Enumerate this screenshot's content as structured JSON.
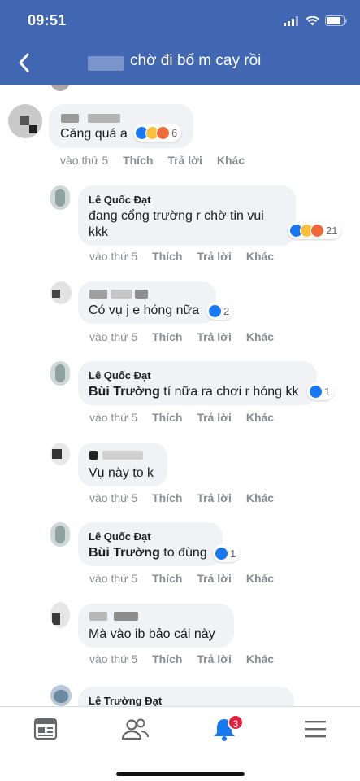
{
  "status_bar": {
    "time": "09:51"
  },
  "header": {
    "title": "chờ đi bố m cay rồi"
  },
  "comments": [
    {
      "text": "Căng quá a",
      "reaction_count": "6",
      "time": "vào thứ 5"
    },
    {
      "name": "Lê Quốc Đạt",
      "text_line1": "đang cổng trường r chờ tin vui",
      "text_line2": "kkk",
      "reaction_count": "21",
      "time": "vào thứ 5"
    },
    {
      "text": "Có vụ j e hóng nữa",
      "reaction_count": "2",
      "time": "vào thứ 5"
    },
    {
      "name": "Lê Quốc Đạt",
      "tag": "Bùi Trường",
      "text": " tí nữa ra chơi r hóng kk",
      "reaction_count": "1",
      "time": "vào thứ 5"
    },
    {
      "text": "Vụ này to k",
      "time": "vào thứ 5"
    },
    {
      "name": "Lê Quốc Đạt",
      "tag": "Bùi Trường",
      "text": " to đùng",
      "reaction_count": "1",
      "time": "vào thứ 5"
    },
    {
      "text": "Mà vào ib bảo cái này",
      "time": "vào thứ 5"
    },
    {
      "name": "Lê Trường Đạt"
    }
  ],
  "actions": {
    "like": "Thích",
    "reply": "Trả lời",
    "more": "Khác"
  },
  "nav": {
    "notification_badge": "3"
  },
  "colors": {
    "header": "#4267b2",
    "like": "#1877f2",
    "badge": "#e41e3f",
    "bubble": "#f0f2f5"
  },
  "icons": [
    "back-arrow-icon",
    "signal-icon",
    "wifi-icon",
    "battery-icon",
    "feed-icon",
    "friends-icon",
    "bell-icon",
    "menu-icon"
  ]
}
